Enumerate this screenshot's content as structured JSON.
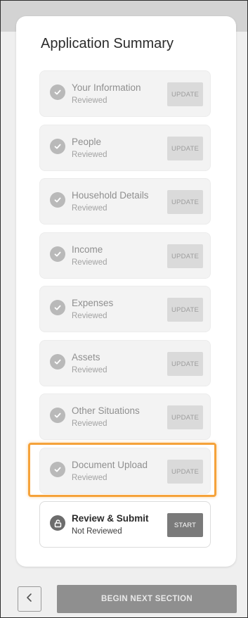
{
  "summary": {
    "title": "Application Summary",
    "sections": [
      {
        "title": "Your Information",
        "status": "Reviewed",
        "action": "UPDATE"
      },
      {
        "title": "People",
        "status": "Reviewed",
        "action": "UPDATE"
      },
      {
        "title": "Household Details",
        "status": "Reviewed",
        "action": "UPDATE"
      },
      {
        "title": "Income",
        "status": "Reviewed",
        "action": "UPDATE"
      },
      {
        "title": "Expenses",
        "status": "Reviewed",
        "action": "UPDATE"
      },
      {
        "title": "Assets",
        "status": "Reviewed",
        "action": "UPDATE"
      },
      {
        "title": "Other Situations",
        "status": "Reviewed",
        "action": "UPDATE"
      },
      {
        "title": "Document Upload",
        "status": "Reviewed",
        "action": "UPDATE",
        "highlighted": true
      },
      {
        "title": "Review & Submit",
        "status": "Not Reviewed",
        "action": "START",
        "active": true
      }
    ]
  },
  "footer": {
    "back_icon": "chevron-left-icon",
    "next_label": "BEGIN NEXT SECTION"
  },
  "colors": {
    "highlight": "#f5a23a",
    "start_button": "#7a7a7a",
    "next_button": "#8f8f8f"
  }
}
